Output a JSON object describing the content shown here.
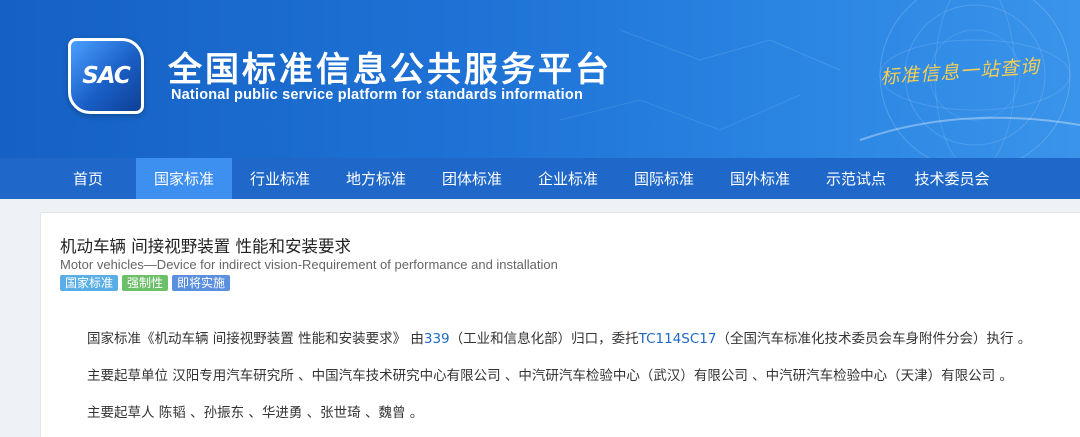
{
  "header": {
    "logo_text": "SAC",
    "title": "全国标准信息公共服务平台",
    "subtitle": "National public service platform  for standards information",
    "slogan": "标准信息一站查询",
    "colors": {
      "banner": "#1f73d6",
      "slogan": "#f4ce55"
    }
  },
  "nav": {
    "items": [
      {
        "label": "首页",
        "active": false
      },
      {
        "label": "国家标准",
        "active": true
      },
      {
        "label": "行业标准",
        "active": false
      },
      {
        "label": "地方标准",
        "active": false
      },
      {
        "label": "团体标准",
        "active": false
      },
      {
        "label": "企业标准",
        "active": false
      },
      {
        "label": "国际标准",
        "active": false
      },
      {
        "label": "国外标准",
        "active": false
      },
      {
        "label": "示范试点",
        "active": false
      },
      {
        "label": "技术委员会",
        "active": false
      }
    ],
    "colors": {
      "bar": "#1f68c9",
      "active": "#3d8ff0"
    }
  },
  "standard": {
    "title": "机动车辆 间接视野装置 性能和安装要求",
    "title_en": "Motor vehicles—Device for indirect vision-Requirement of performance and installation",
    "badges": [
      {
        "label": "国家标准",
        "color": "#5aaee8"
      },
      {
        "label": "强制性",
        "color": "#6cc06a"
      },
      {
        "label": "即将实施",
        "color": "#5b8fe0"
      }
    ],
    "p1": {
      "a": "国家标准《机动车辆 间接视野装置 性能和安装要求》 由",
      "link1": "339",
      "b": "（工业和信息化部）归口，委托",
      "link2": "TC114SC17",
      "c": "（全国汽车标准化技术委员会车身附件分会）执行 。"
    },
    "p2": "主要起草单位 汉阳专用汽车研究所 、中国汽车技术研究中心有限公司 、中汽研汽车检验中心（武汉）有限公司 、中汽研汽车检验中心（天津）有限公司 。",
    "p3": "主要起草人 陈韬 、孙振东 、华进勇 、张世琦 、魏曾 。"
  }
}
